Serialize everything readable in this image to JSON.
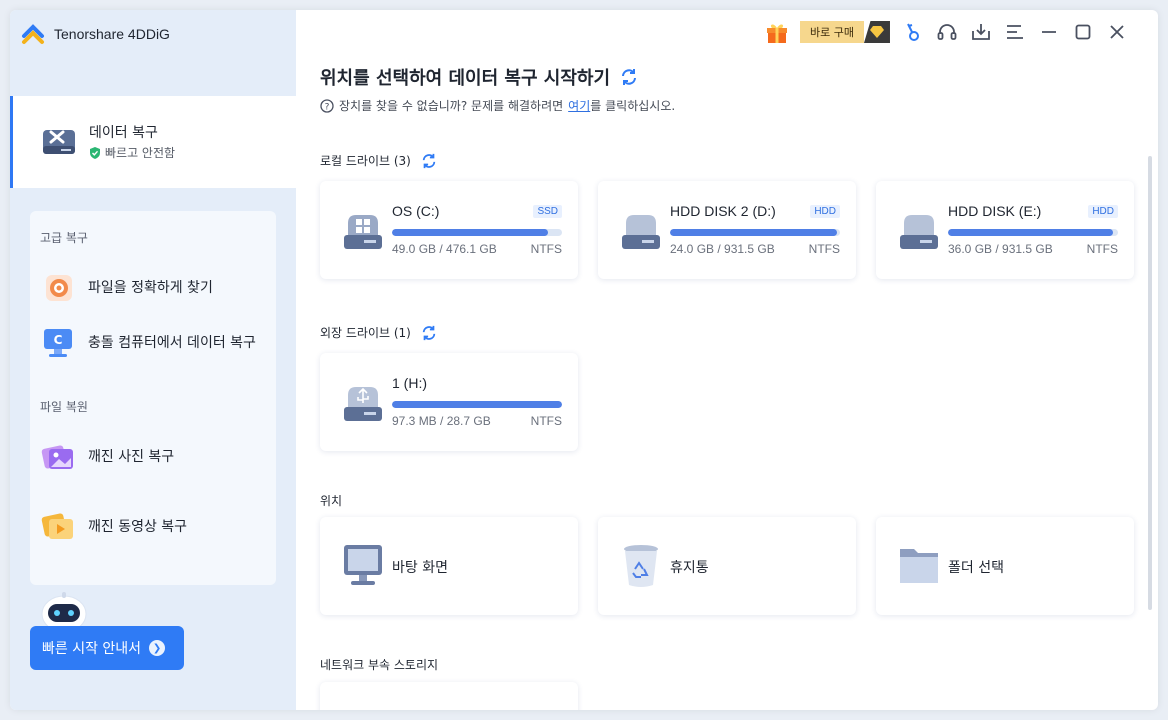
{
  "app": {
    "title": "Tenorshare 4DDiG"
  },
  "topbar": {
    "buy_label": "바로 구매"
  },
  "sidebar": {
    "active": {
      "title": "데이터 복구",
      "subtitle": "빠르고 안전함"
    },
    "advanced_label": "고급 복구",
    "advanced_items": [
      {
        "label": "파일을 정확하게 찾기"
      },
      {
        "label": "충돌 컴퓨터에서 데이터 복구"
      }
    ],
    "repair_label": "파일 복원",
    "repair_items": [
      {
        "label": "깨진 사진 복구"
      },
      {
        "label": "깨진 동영상 복구"
      }
    ],
    "guide_button": "빠른 시작 안내서"
  },
  "main": {
    "title": "위치를 선택하여 데이터 복구 시작하기",
    "help_prefix": "장치를 찾을 수 없습니까? 문제를 해결하려면",
    "help_link": "여기",
    "help_suffix": "를 클릭하십시오.",
    "local_label": "로컬 드라이브 (3)",
    "local_drives": [
      {
        "name": "OS (C:)",
        "tag": "SSD",
        "size": "49.0 GB / 476.1 GB",
        "fs": "NTFS",
        "usage": 0.92
      },
      {
        "name": "HDD DISK 2 (D:)",
        "tag": "HDD",
        "size": "24.0 GB / 931.5 GB",
        "fs": "NTFS",
        "usage": 0.98
      },
      {
        "name": "HDD DISK (E:)",
        "tag": "HDD",
        "size": "36.0 GB / 931.5 GB",
        "fs": "NTFS",
        "usage": 0.97
      }
    ],
    "external_label": "외장 드라이브 (1)",
    "external_drives": [
      {
        "name": "1 (H:)",
        "size": "97.3 MB / 28.7 GB",
        "fs": "NTFS",
        "usage": 1.0
      }
    ],
    "location_label": "위치",
    "locations": [
      {
        "label": "바탕 화면"
      },
      {
        "label": "휴지통"
      },
      {
        "label": "폴더 선택"
      }
    ],
    "network_label": "네트워크 부속 스토리지"
  },
  "colors": {
    "accent": "#2f7bf5",
    "bar_fill": "#4f7fe6",
    "sidebar_bg": "#e4edf9"
  }
}
